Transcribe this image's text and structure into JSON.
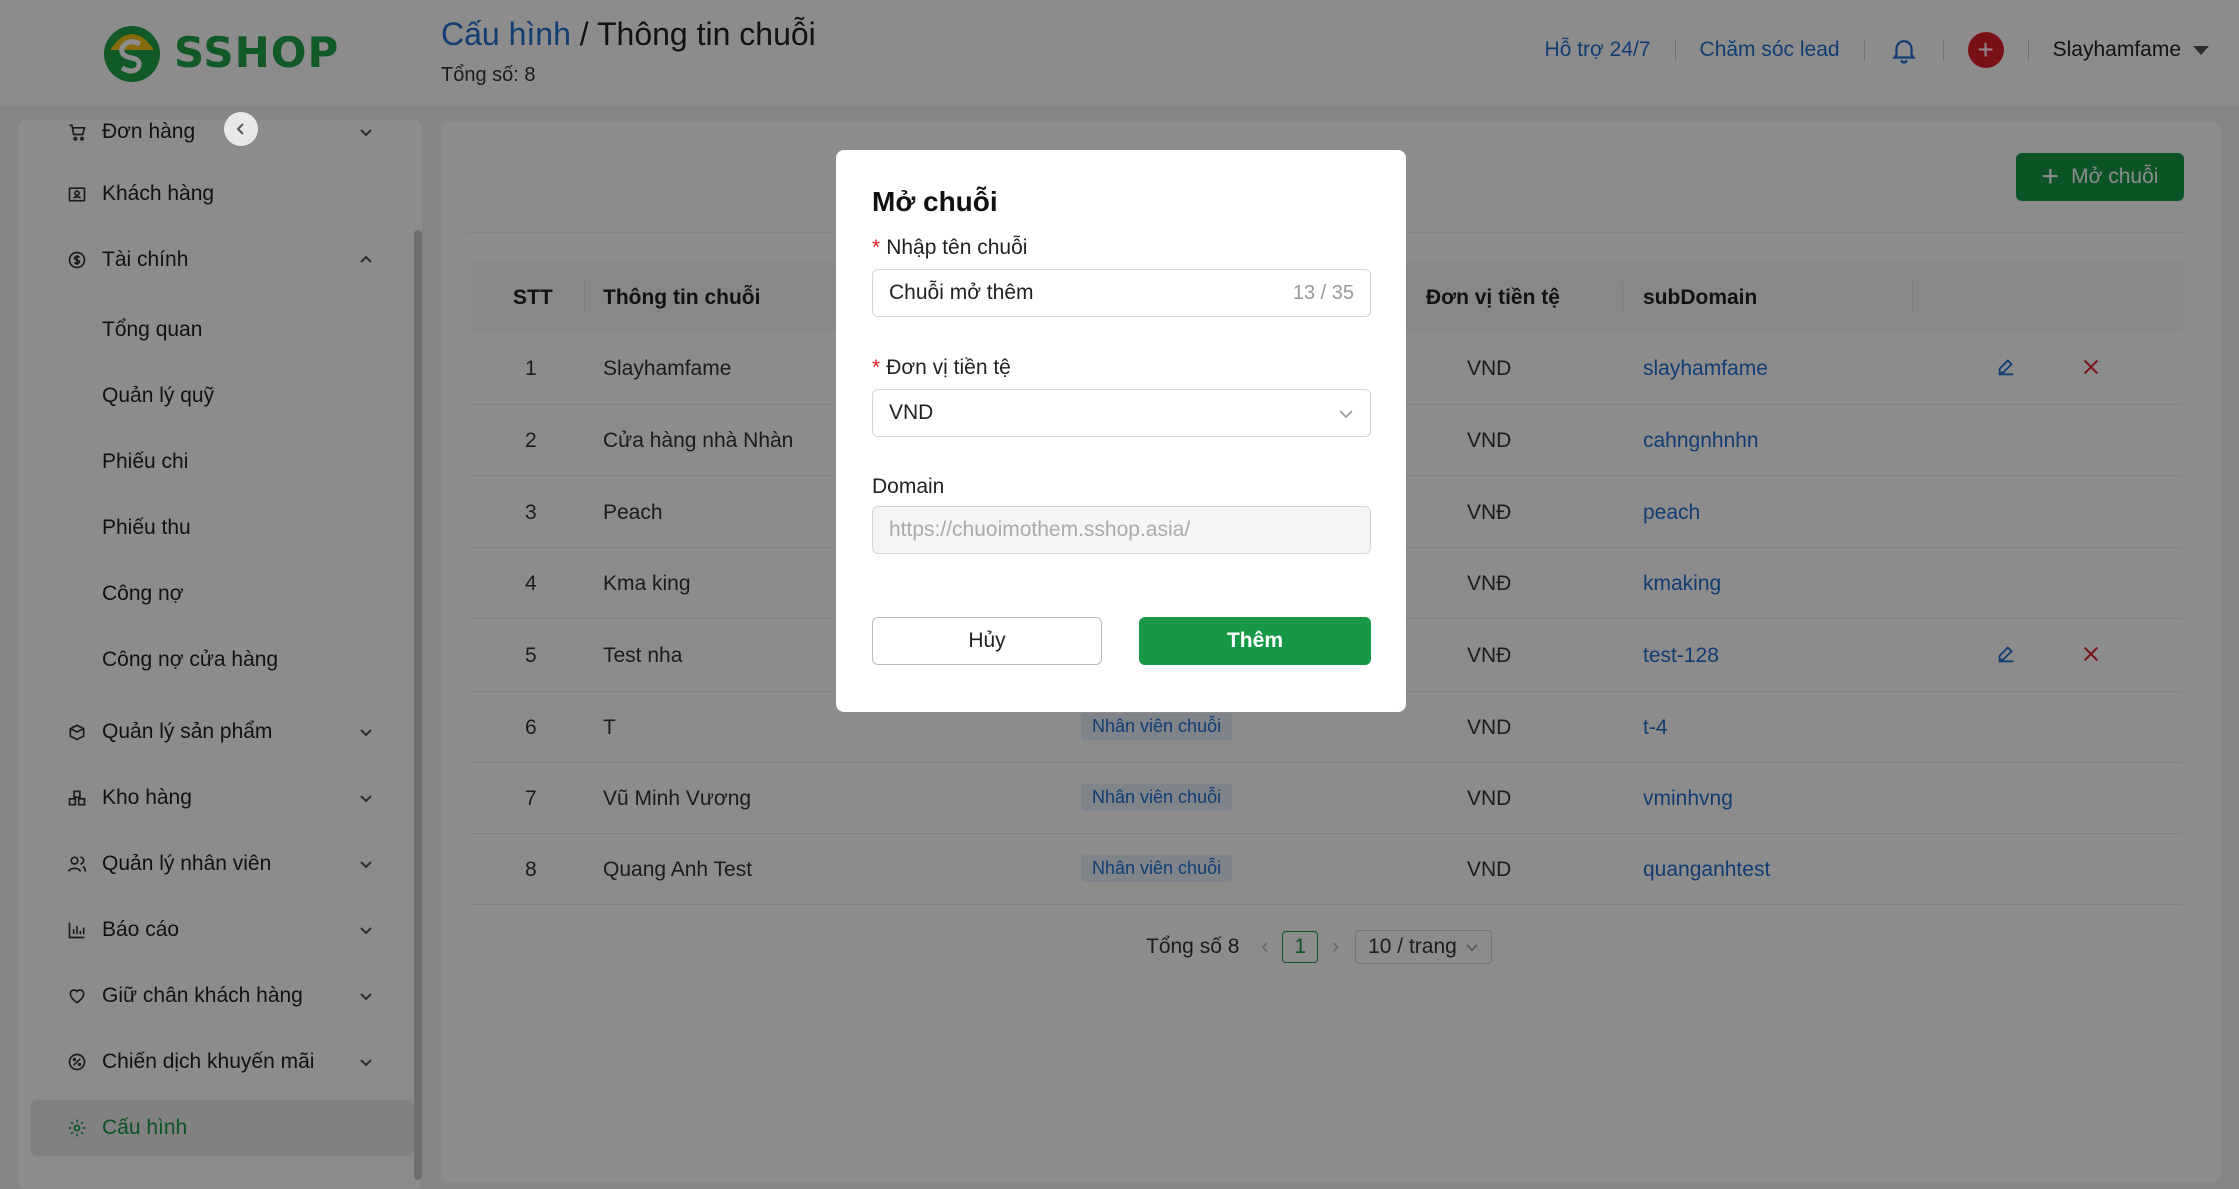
{
  "brand": {
    "name": "SSHOP"
  },
  "header": {
    "breadcrumb_parent": "Cấu hình",
    "breadcrumb_sep": "/",
    "breadcrumb_current": "Thông tin chuỗi",
    "total": "Tổng số: 8",
    "support": "Hỗ trợ 24/7",
    "lead_care": "Chăm sóc lead",
    "plus": "+",
    "user": "Slayhamfame"
  },
  "sidebar": {
    "items": [
      {
        "label": "Đơn hàng",
        "icon": "cart-icon"
      },
      {
        "label": "Khách hàng",
        "icon": "contact-card-icon"
      },
      {
        "label": "Tài chính",
        "icon": "dollar-circle-icon"
      },
      {
        "label": "Tổng quan"
      },
      {
        "label": "Quản lý quỹ"
      },
      {
        "label": "Phiếu chi"
      },
      {
        "label": "Phiếu thu"
      },
      {
        "label": "Công nợ"
      },
      {
        "label": "Công nợ cửa hàng"
      },
      {
        "label": "Quản lý sản phẩm",
        "icon": "box-icon"
      },
      {
        "label": "Kho hàng",
        "icon": "warehouse-icon"
      },
      {
        "label": "Quản lý nhân viên",
        "icon": "users-icon"
      },
      {
        "label": "Báo cáo",
        "icon": "bar-chart-icon"
      },
      {
        "label": "Giữ chân khách hàng",
        "icon": "heart-icon"
      },
      {
        "label": "Chiến dịch khuyến mãi",
        "icon": "percent-icon"
      },
      {
        "label": "Cấu hình",
        "icon": "gear-icon"
      }
    ]
  },
  "toolbar": {
    "open_label": "Mở chuỗi",
    "open_plus": "+"
  },
  "table": {
    "columns": [
      "STT",
      "Thông tin chuỗi",
      "Đơn vị tiền tệ",
      "subDomain"
    ],
    "rows": [
      {
        "stt": "1",
        "name": "Slayhamfame",
        "role": "",
        "currency": "VND",
        "subdomain": "slayhamfame"
      },
      {
        "stt": "2",
        "name": "Cửa hàng nhà Nhàn",
        "role": "",
        "currency": "VND",
        "subdomain": "cahngnhnhn"
      },
      {
        "stt": "3",
        "name": "Peach",
        "role": "",
        "currency": "VNĐ",
        "subdomain": "peach"
      },
      {
        "stt": "4",
        "name": "Kma king",
        "role": "",
        "currency": "VNĐ",
        "subdomain": "kmaking"
      },
      {
        "stt": "5",
        "name": "Test nha",
        "role": "",
        "currency": "VNĐ",
        "subdomain": "test-128"
      },
      {
        "stt": "6",
        "name": "T",
        "role": "Nhân viên chuỗi",
        "currency": "VND",
        "subdomain": "t-4"
      },
      {
        "stt": "7",
        "name": "Vũ Minh Vương",
        "role": "Nhân viên chuỗi",
        "currency": "VND",
        "subdomain": "vminhvng"
      },
      {
        "stt": "8",
        "name": "Quang Anh Test",
        "role": "Nhân viên chuỗi",
        "currency": "VND",
        "subdomain": "quanganhtest"
      }
    ]
  },
  "pagination": {
    "total": "Tổng số 8",
    "page": "1",
    "page_size": "10 / trang"
  },
  "modal": {
    "title": "Mở chuỗi",
    "name_label": "Nhập tên chuỗi",
    "name_value": "Chuỗi mở thêm",
    "name_counter": "13 / 35",
    "currency_label": "Đơn vị tiền tệ",
    "currency_value": "VND",
    "domain_label": "Domain",
    "domain_placeholder": "https://chuoimothem.sshop.asia/",
    "cancel_label": "Hủy",
    "add_label": "Thêm",
    "required_mark": "*"
  },
  "colors": {
    "brand_green": "#169846",
    "link_blue": "#1f6fd1",
    "danger_red": "#e11d2a"
  }
}
